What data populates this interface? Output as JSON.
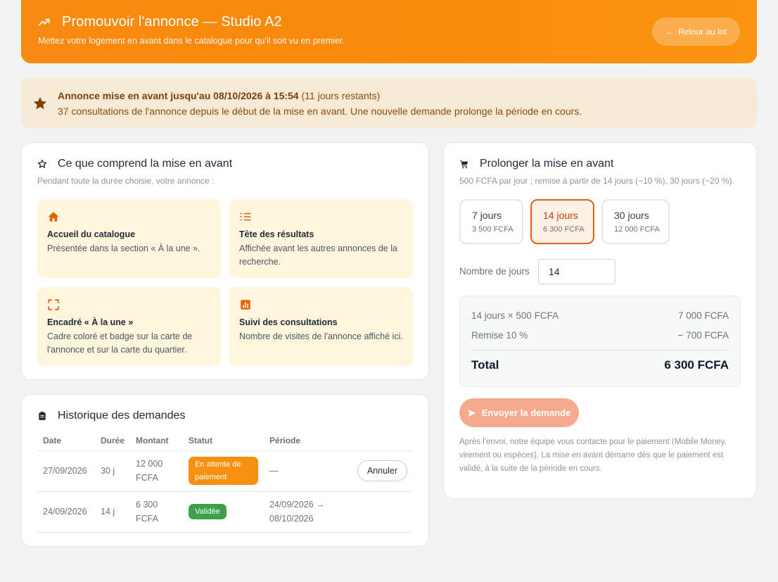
{
  "header": {
    "title": "Promouvoir l'annonce — Studio A2",
    "subtitle": "Mettez votre logement en avant dans le catalogue pour qu'il soit vu en premier.",
    "back_label": "Retour au lot"
  },
  "alert": {
    "bold": "Annonce mise en avant jusqu'au 08/10/2026 à 15:54",
    "remaining": " (11 jours restants)",
    "views": "37 consultations de l'annonce depuis le début de la mise en avant. Une nouvelle demande prolonge la période en cours."
  },
  "features": {
    "title": "Ce que comprend la mise en avant",
    "subtitle": "Pendant toute la durée choisie, votre annonce :",
    "items": [
      {
        "title": "Accueil du catalogue",
        "desc": "Présentée dans la section « À la une »."
      },
      {
        "title": "Tête des résultats",
        "desc": "Affichée avant les autres annonces de la recherche."
      },
      {
        "title": "Encadré « À la une »",
        "desc": "Cadre coloré et badge sur la carte de l'annonce et sur la carte du quartier."
      },
      {
        "title": "Suivi des consultations",
        "desc": "Nombre de visites de l'annonce affiché ici."
      }
    ]
  },
  "history": {
    "title": "Historique des demandes",
    "columns": [
      "Date",
      "Durée",
      "Montant",
      "Statut",
      "Période"
    ],
    "rows": [
      {
        "date": "27/09/2026",
        "duration": "30 j",
        "amount": "12 000 FCFA",
        "status": "En attente de paiement",
        "period": "—",
        "action": "Annuler"
      },
      {
        "date": "24/09/2026",
        "duration": "14 j",
        "amount": "6 300 FCFA",
        "status": "Validée",
        "period": "24/09/2026 → 08/10/2026",
        "action": ""
      }
    ]
  },
  "extend": {
    "title": "Prolonger la mise en avant",
    "subtitle": "500 FCFA par jour ; remise à partir de 14 jours (−10 %), 30 jours (−20 %).",
    "options": [
      {
        "label": "7 jours",
        "price": "3 500 FCFA"
      },
      {
        "label": "14 jours",
        "price": "6 300 FCFA"
      },
      {
        "label": "30 jours",
        "price": "12 000 FCFA"
      }
    ],
    "days_label": "Nombre de jours",
    "days_value": "14",
    "summary": {
      "line1_label": "14 jours × 500 FCFA",
      "line1_value": "7 000 FCFA",
      "line2_label": "Remise 10 %",
      "line2_value": "− 700 FCFA",
      "total_label": "Total",
      "total_value": "6 300 FCFA"
    },
    "send_label": "Envoyer la demande",
    "note": "Après l'envoi, notre équipe vous contacte pour le paiement (Mobile Money, virement ou espèces). La mise en avant démarre dès que le paiement est validé, à la suite de la période en cours."
  },
  "colors": {
    "accent": "#f78a10",
    "selected": "#e4600d",
    "pending": "#f7900f",
    "validated": "#3ea04a"
  }
}
